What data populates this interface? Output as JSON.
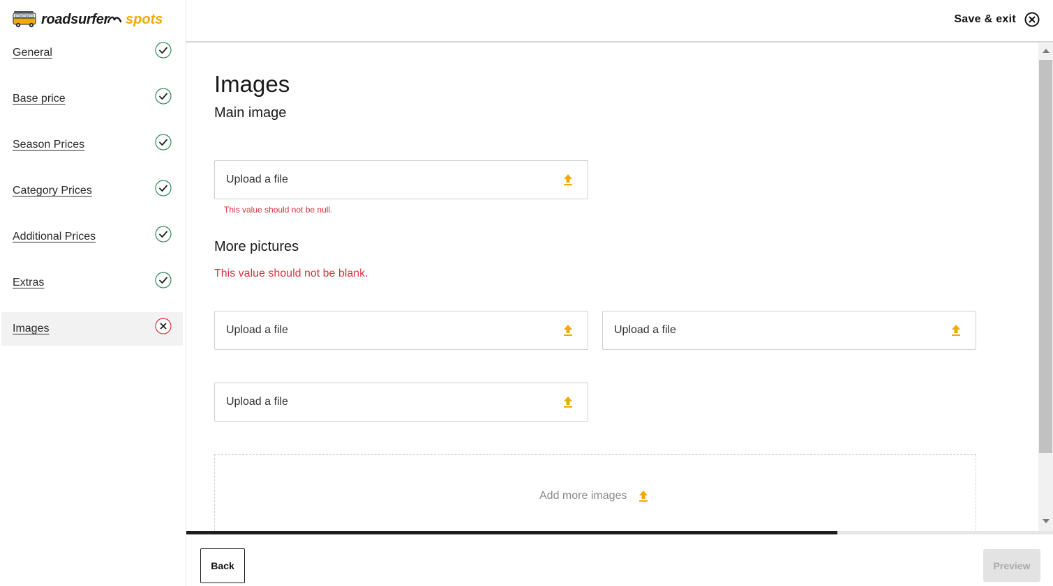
{
  "brand": {
    "name": "roadsurfer",
    "product": "spots",
    "accent_color": "#f2a900"
  },
  "header": {
    "save_exit_label": "Save & exit",
    "close_icon": "circle-x-icon"
  },
  "sidebar": {
    "items": [
      {
        "label": "General",
        "status": "complete",
        "status_icon": "check-circle-icon"
      },
      {
        "label": "Base price",
        "status": "complete",
        "status_icon": "check-circle-icon"
      },
      {
        "label": "Season Prices",
        "status": "complete",
        "status_icon": "check-circle-icon"
      },
      {
        "label": "Category Prices",
        "status": "complete",
        "status_icon": "check-circle-icon"
      },
      {
        "label": "Additional Prices",
        "status": "complete",
        "status_icon": "check-circle-icon"
      },
      {
        "label": "Extras",
        "status": "complete",
        "status_icon": "check-circle-icon"
      },
      {
        "label": "Images",
        "status": "error",
        "status_icon": "x-circle-icon",
        "active": true
      }
    ],
    "check_color": "#2e8b57",
    "error_color": "#d9333f"
  },
  "main": {
    "title": "Images",
    "main_image": {
      "heading": "Main image",
      "upload_label": "Upload a file",
      "error": "This value should not be null."
    },
    "more_pictures": {
      "heading": "More pictures",
      "error": "This value should not be blank.",
      "uploads": [
        {
          "label": "Upload a file"
        },
        {
          "label": "Upload a file"
        },
        {
          "label": "Upload a file"
        }
      ],
      "add_more_label": "Add more images"
    },
    "upload_icon": "upload-arrow-icon"
  },
  "progress": {
    "fraction": 0.751
  },
  "footer": {
    "back_label": "Back",
    "preview_label": "Preview",
    "preview_disabled": true
  },
  "colors": {
    "error": "#d9333f",
    "upload_icon": "#f2a900",
    "progress_fill": "#1e1e1e"
  }
}
